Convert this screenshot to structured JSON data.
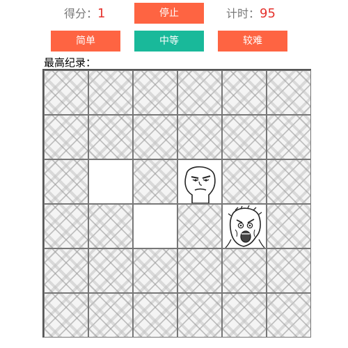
{
  "header": {
    "score_label": "得分：",
    "score_value": "1",
    "timer_label": "计时：",
    "timer_value": "95"
  },
  "buttons": {
    "stop": "停止",
    "easy": "简单",
    "medium": "中等",
    "hard": "较难"
  },
  "record_label": "最高纪录：",
  "board": {
    "rows": 6,
    "cols": 6,
    "cells": [
      [
        "covered",
        "covered",
        "covered",
        "covered",
        "covered",
        "covered"
      ],
      [
        "covered",
        "covered",
        "covered",
        "covered",
        "covered",
        "covered"
      ],
      [
        "covered",
        "empty",
        "covered",
        "meh-face",
        "covered",
        "covered"
      ],
      [
        "covered",
        "covered",
        "empty",
        "covered",
        "y-u-no-face",
        "covered"
      ],
      [
        "covered",
        "covered",
        "covered",
        "covered",
        "covered",
        "covered"
      ],
      [
        "covered",
        "covered",
        "covered",
        "covered",
        "covered",
        "covered"
      ]
    ]
  },
  "colors": {
    "button_orange": "#fe6442",
    "button_teal": "#19b99a",
    "value_red": "#e5322d"
  }
}
